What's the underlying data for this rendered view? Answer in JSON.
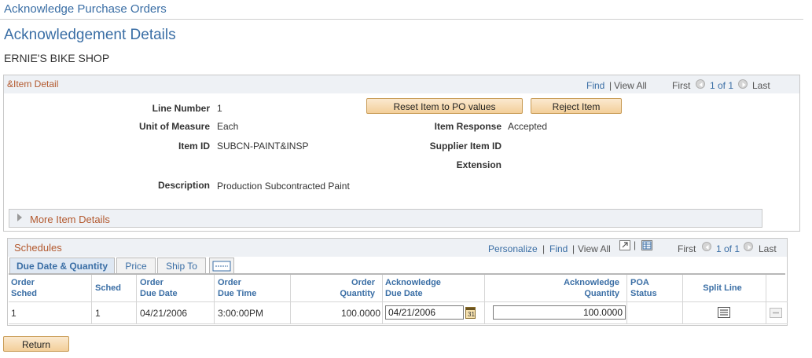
{
  "breadcrumb": "Acknowledge Purchase Orders",
  "page_title": "Acknowledgement Details",
  "supplier_name": "ERNIE'S BIKE SHOP",
  "item_panel": {
    "title": "&Item Detail",
    "find": "Find",
    "view_all": "View All",
    "first": "First",
    "count": "1 of 1",
    "last": "Last",
    "fields": {
      "line_number_label": "Line Number",
      "line_number": "1",
      "uom_label": "Unit of Measure",
      "uom": "Each",
      "item_id_label": "Item ID",
      "item_id": "SUBCN-PAINT&INSP",
      "description_label": "Description",
      "description": "Production Subcontracted Paint",
      "item_response_label": "Item Response",
      "item_response": "Accepted",
      "supplier_item_id_label": "Supplier Item ID",
      "extension_label": "Extension"
    },
    "buttons": {
      "reset": "Reset Item to PO values",
      "reject": "Reject Item"
    },
    "more_details": "More Item Details"
  },
  "schedules": {
    "title": "Schedules",
    "personalize": "Personalize",
    "find": "Find",
    "view_all": "View All",
    "first": "First",
    "count": "1 of 1",
    "last": "Last",
    "tabs": [
      "Due Date & Quantity",
      "Price",
      "Ship To"
    ],
    "headers": {
      "order_sched": [
        "Order",
        "Sched"
      ],
      "sched": "Sched",
      "order_due_date": [
        "Order",
        "Due Date"
      ],
      "order_due_time": [
        "Order",
        "Due Time"
      ],
      "order_quantity": [
        "Order",
        "Quantity"
      ],
      "ack_due_date": [
        "Acknowledge",
        "Due Date"
      ],
      "ack_quantity": [
        "Acknowledge",
        "Quantity"
      ],
      "poa_status": [
        "POA",
        "Status"
      ],
      "split_line": "Split Line"
    },
    "row": {
      "order_sched": "1",
      "sched": "1",
      "order_due_date": "04/21/2006",
      "order_due_time": "3:00:00PM",
      "order_quantity": "100.0000",
      "ack_due_date": "04/21/2006",
      "ack_quantity": "100.0000",
      "poa_status": ""
    }
  },
  "return_button": "Return",
  "colors": {
    "link": "#3a6ea5",
    "section_title": "#b3592e",
    "button_fill": "#f3cf99"
  }
}
